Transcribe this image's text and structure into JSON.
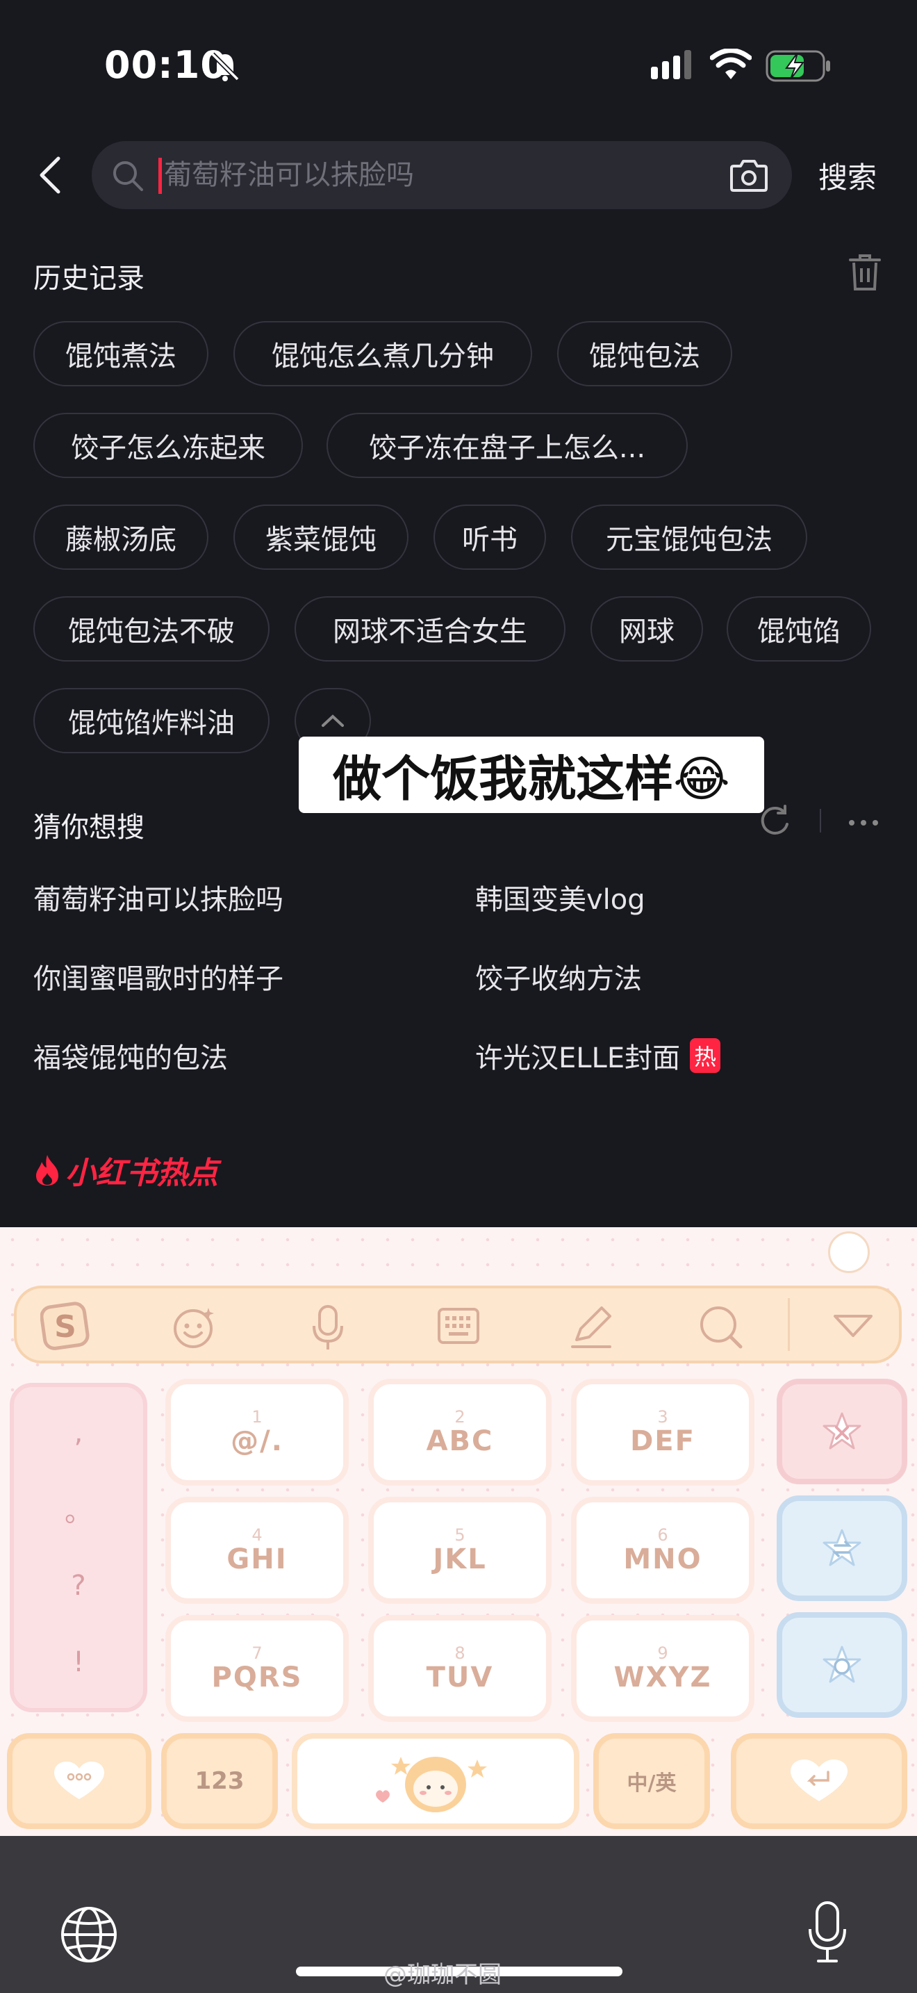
{
  "status_bar": {
    "time": "00:10",
    "icons": [
      "bell-slash-icon",
      "signal-icon",
      "wifi-icon",
      "battery-charging-icon"
    ]
  },
  "search": {
    "placeholder": "葡萄籽油可以抹脸吗",
    "value": "",
    "button_label": "搜索",
    "icons": [
      "back-icon",
      "search-icon",
      "camera-icon"
    ]
  },
  "history": {
    "title": "历史记录",
    "chips": [
      "馄饨煮法",
      "馄饨怎么煮几分钟",
      "馄饨包法",
      "饺子怎么冻起来",
      "饺子冻在盘子上怎么...",
      "藤椒汤底",
      "紫菜馄饨",
      "听书",
      "元宝馄饨包法",
      "馄饨包法不破",
      "网球不适合女生",
      "网球",
      "馄饨馅",
      "馄饨馅炸料油"
    ]
  },
  "overlay": {
    "caption": "做个饭我就这样😂"
  },
  "guess": {
    "title": "猜你想搜",
    "items": [
      "葡萄籽油可以抹脸吗",
      "韩国变美vlog",
      "你闺蜜唱歌时的样子",
      "饺子收纳方法",
      "福袋馄饨的包法",
      "许光汉ELLE封面"
    ],
    "hot_badge": "热"
  },
  "hot_brand": {
    "label": "小红书热点"
  },
  "keyboard": {
    "toolbar_icons": [
      "sogou-logo-icon",
      "emoji-icon",
      "microphone-icon",
      "keyboard-icon",
      "pen-icon",
      "search-icon",
      "collapse-keyboard-icon"
    ],
    "punctuation": [
      ",",
      "。",
      "?",
      "!"
    ],
    "letter_keys": [
      {
        "num": "1",
        "label": "@/."
      },
      {
        "num": "2",
        "label": "ABC"
      },
      {
        "num": "3",
        "label": "DEF"
      },
      {
        "num": "4",
        "label": "GHI"
      },
      {
        "num": "5",
        "label": "JKL"
      },
      {
        "num": "6",
        "label": "MNO"
      },
      {
        "num": "7",
        "label": "PQRS"
      },
      {
        "num": "8",
        "label": "TUV"
      },
      {
        "num": "9",
        "label": "WXYZ"
      }
    ],
    "numbers_label": "123",
    "lang_label": "中/英"
  },
  "bottom": {
    "watermark": "@珈珈不圆"
  },
  "colors": {
    "background": "#18181f",
    "accent": "#ff2442",
    "keyboard_bg": "#fdf3f3"
  }
}
